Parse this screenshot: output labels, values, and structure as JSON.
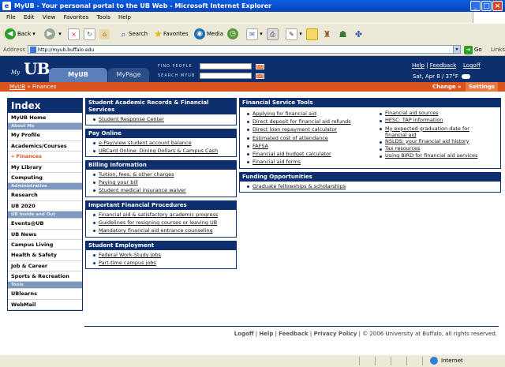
{
  "window": {
    "title": "MyUB - Your personal portal to the UB Web - Microsoft Internet Explorer"
  },
  "menu": [
    "File",
    "Edit",
    "View",
    "Favorites",
    "Tools",
    "Help"
  ],
  "toolbar": {
    "back": "Back",
    "search": "Search",
    "favorites": "Favorites",
    "media": "Media"
  },
  "address": {
    "label": "Address",
    "url": "http://myub.buffalo.edu",
    "go": "Go",
    "links": "Links"
  },
  "header": {
    "logo_my": "My",
    "logo_ub": "UB",
    "tab_active": "MyUB",
    "tab_other": "MyPage",
    "find_people_label": "FIND PEOPLE",
    "search_label": "SEARCH MYUB",
    "go_label": "GO",
    "help": "Help",
    "feedback": "Feedback",
    "logoff": "Logoff",
    "date": "Sat, Apr 8 / 37°F"
  },
  "breadcrumb": {
    "root": "MyUB",
    "sep": "»",
    "current": "Finances",
    "change": "Change »",
    "settings": "Settings"
  },
  "index": {
    "title": "Index",
    "items": [
      {
        "label": "MyUB Home",
        "type": "item"
      },
      {
        "label": "About Me",
        "type": "section"
      },
      {
        "label": "My Profile",
        "type": "item"
      },
      {
        "label": "Academics/Courses",
        "type": "item"
      },
      {
        "label": "» Finances",
        "type": "current"
      },
      {
        "label": "My Library",
        "type": "item"
      },
      {
        "label": "Computing",
        "type": "item"
      },
      {
        "label": "Administrative",
        "type": "section"
      },
      {
        "label": "Research",
        "type": "item"
      },
      {
        "label": "UB 2020",
        "type": "item"
      },
      {
        "label": "UB Inside and Out",
        "type": "section"
      },
      {
        "label": "Events@UB",
        "type": "item"
      },
      {
        "label": "UB News",
        "type": "item"
      },
      {
        "label": "Campus Living",
        "type": "item"
      },
      {
        "label": "Health & Safety",
        "type": "item"
      },
      {
        "label": "Job & Career",
        "type": "item"
      },
      {
        "label": "Sports & Recreation",
        "type": "item"
      },
      {
        "label": "Tools",
        "type": "section"
      },
      {
        "label": "UBlearns",
        "type": "item"
      },
      {
        "label": "WebMail",
        "type": "item"
      }
    ]
  },
  "boxes": {
    "sarfs": {
      "title": "Student Academic Records & Financial Services",
      "links": [
        "Student Response Center"
      ]
    },
    "payonline": {
      "title": "Pay Online",
      "links": [
        "e-Pay/view student account balance",
        "UBCard Online: Dining Dollars & Campus Cash"
      ]
    },
    "billing": {
      "title": "Billing Information",
      "links": [
        "Tuition, fees, & other charges",
        "Paying your bill",
        "Student medical insurance waiver"
      ]
    },
    "procedures": {
      "title": "Important Financial Procedures",
      "links": [
        "Financial aid & satisfactory academic progress",
        "Guidelines for resigning courses or leaving UB",
        "Mandatory financial aid entrance counseling"
      ]
    },
    "employment": {
      "title": "Student Employment",
      "links": [
        "Federal Work-Study jobs",
        "Part-time campus jobs"
      ]
    },
    "fst": {
      "title": "Financial Service Tools",
      "col1": [
        "Applying for financial aid",
        "Direct deposit for financial aid refunds",
        "Direct loan repayment calculator",
        "Estimated cost of attendance",
        "FAFSA",
        "Financial aid budget calculator",
        "Financial aid forms"
      ],
      "col2": [
        "Financial aid sources",
        "HESC: TAP information",
        "My expected graduation date for financial aid",
        "NSLDS: your financial aid history",
        "Tax resources",
        "Using BIRD for financial aid services"
      ]
    },
    "funding": {
      "title": "Funding Opportunities",
      "links": [
        "Graduate fellowships & scholarships"
      ]
    }
  },
  "footer": {
    "logoff": "Logoff",
    "help": "Help",
    "feedback": "Feedback",
    "privacy": "Privacy Policy",
    "copyright": "© 2006 University at Buffalo, all rights reserved."
  },
  "status": {
    "left": "",
    "zone": "Internet"
  }
}
